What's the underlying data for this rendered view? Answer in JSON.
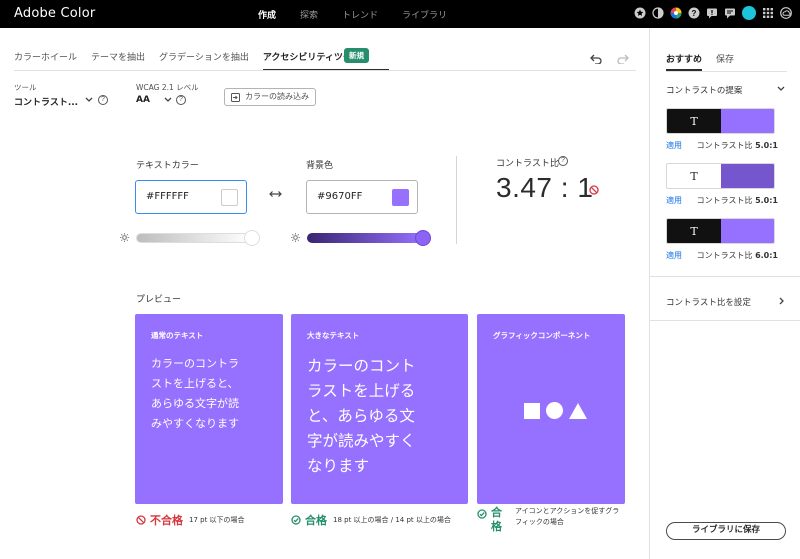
{
  "app": {
    "title": "Adobe Color"
  },
  "topnav": {
    "items": [
      {
        "label": "作成",
        "active": true
      },
      {
        "label": "探索",
        "active": false
      },
      {
        "label": "トレンド",
        "active": false
      },
      {
        "label": "ライブラリ",
        "active": false
      }
    ],
    "icons": [
      "star-icon",
      "contrast-icon",
      "color-wheel-icon",
      "help-icon",
      "feedback-icon",
      "chat-icon",
      "avatar",
      "apps-grid-icon",
      "creative-cloud-icon"
    ]
  },
  "tabs": {
    "items": [
      {
        "label": "カラーホイール"
      },
      {
        "label": "テーマを抽出"
      },
      {
        "label": "グラデーションを抽出"
      },
      {
        "label": "アクセシビリティツール",
        "active": true
      }
    ],
    "new_badge": "新規"
  },
  "options": {
    "tool_label": "ツール",
    "tool_value": "コントラスト...",
    "wcag_label": "WCAG 2.1 レベル",
    "wcag_value": "AA",
    "import_label": "カラーの読み込み"
  },
  "colors": {
    "text_label": "テキストカラー",
    "text_hex": "#FFFFFF",
    "text_color": "#FFFFFF",
    "text_brightness": 1.0,
    "bg_label": "背景色",
    "bg_hex": "#9670FF",
    "bg_color": "#9670FF",
    "bg_brightness": 1.0
  },
  "contrast": {
    "label": "コントラスト比",
    "value": "3.47 : 1",
    "status": "fail"
  },
  "preview": {
    "label": "プレビュー",
    "cards": [
      {
        "title": "通常のテキスト",
        "lines": [
          "カラーのコントラ",
          "ストを上げると、",
          "あらゆる文字が読",
          "みやすくなります"
        ],
        "result": "不合格",
        "result_status": "fail",
        "note": "17 pt 以下の場合"
      },
      {
        "title": "大きなテキスト",
        "lines": [
          "カラーのコント",
          "ラストを上げる",
          "と、あらゆる文",
          "字が読みやすく",
          "なります"
        ],
        "result": "合格",
        "result_status": "pass",
        "note": "18 pt 以上の場合 / 14 pt 以上の場合"
      },
      {
        "title": "グラフィックコンポーネント",
        "shapes": [
          "square",
          "circle",
          "triangle"
        ],
        "result": "合格",
        "result_status": "pass",
        "note": "アイコンとアクションを促すグラフィックの場合"
      }
    ]
  },
  "right_panel": {
    "tabs": [
      {
        "label": "おすすめ",
        "active": true
      },
      {
        "label": "保存",
        "active": false
      }
    ],
    "suggestions_title": "コントラストの提案",
    "suggestions": [
      {
        "glyph": "T",
        "text_color": "#FFFFFF",
        "left_bg": "#111111",
        "right_bg": "#9670FF",
        "apply": "適用",
        "ratio_label": "コントラスト比",
        "ratio": "5.0:1"
      },
      {
        "glyph": "T",
        "text_color": "#222222",
        "left_bg": "#FFFFFF",
        "right_bg": "#7556CC",
        "apply": "適用",
        "ratio_label": "コントラスト比",
        "ratio": "5.0:1"
      },
      {
        "glyph": "T",
        "text_color": "#FFFFFF",
        "left_bg": "#111111",
        "right_bg": "#9670FF",
        "apply": "適用",
        "ratio_label": "コントラスト比",
        "ratio": "6.0:1"
      }
    ],
    "set_ratio_label": "コントラスト比を設定",
    "save_button": "ライブラリに保存"
  }
}
